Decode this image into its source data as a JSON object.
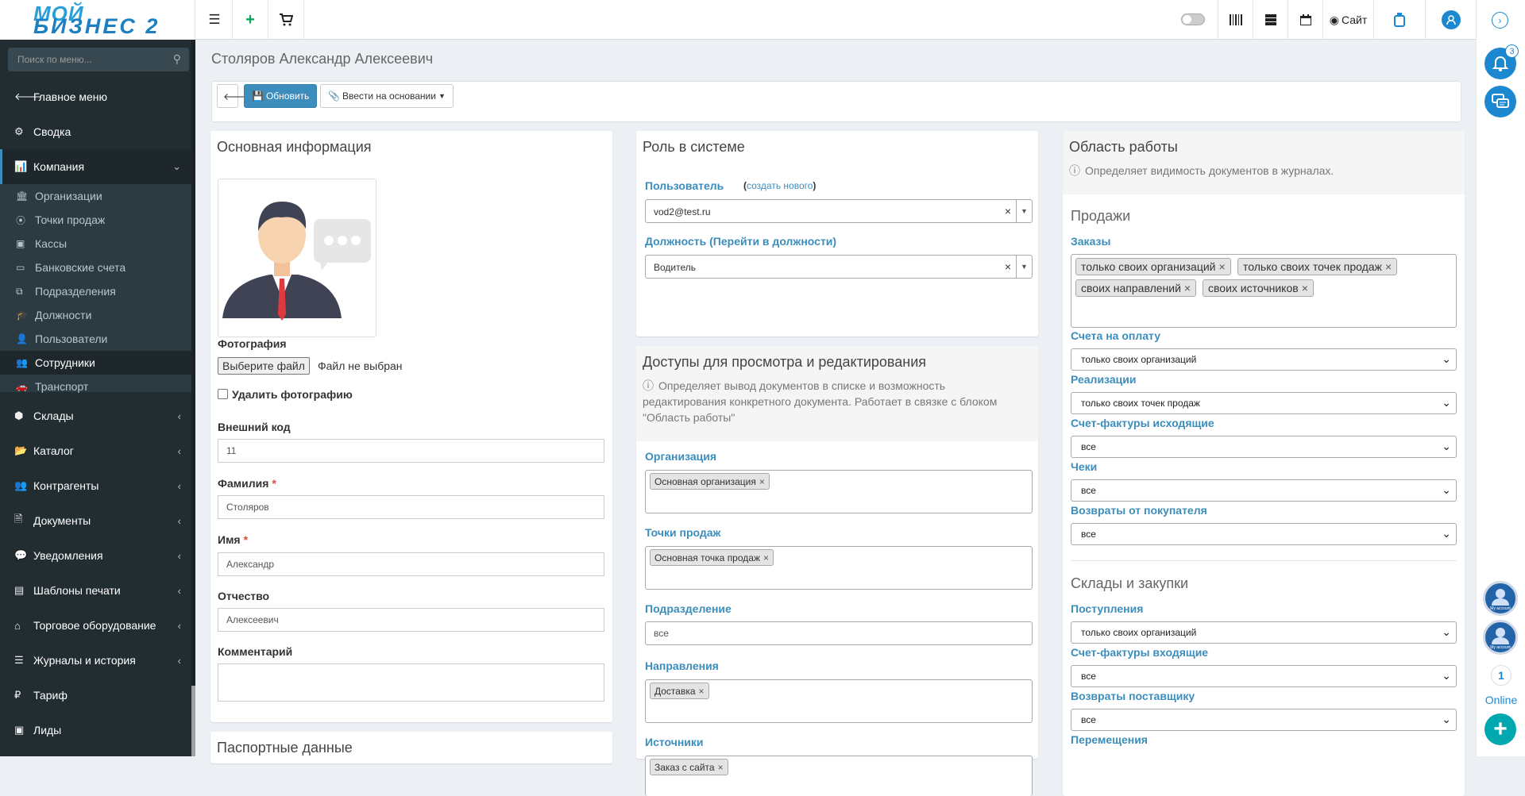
{
  "logo": {
    "line1": "МОЙ",
    "line2": "БИЗНЕС 2"
  },
  "topbar": {
    "site_label": "Сайт"
  },
  "sidebar": {
    "search_placeholder": "Поиск по меню...",
    "items": [
      {
        "label": "Главное меню"
      },
      {
        "label": "Сводка"
      },
      {
        "label": "Компания"
      },
      {
        "label": "Склады"
      },
      {
        "label": "Каталог"
      },
      {
        "label": "Контрагенты"
      },
      {
        "label": "Документы"
      },
      {
        "label": "Уведомления"
      },
      {
        "label": "Шаблоны печати"
      },
      {
        "label": "Торговое оборудование"
      },
      {
        "label": "Журналы и история"
      },
      {
        "label": "Тариф"
      },
      {
        "label": "Лиды"
      }
    ],
    "sub": [
      {
        "label": "Организации"
      },
      {
        "label": "Точки продаж"
      },
      {
        "label": "Кассы"
      },
      {
        "label": "Банковские счета"
      },
      {
        "label": "Подразделения"
      },
      {
        "label": "Должности"
      },
      {
        "label": "Пользователи"
      },
      {
        "label": "Сотрудники"
      },
      {
        "label": "Транспорт"
      }
    ]
  },
  "page": {
    "title": "Столяров Александр Алексеевич",
    "refresh_label": "Обновить",
    "base_label": "Ввести на основании"
  },
  "main": {
    "header": "Основная информация",
    "photo_label": "Фотография",
    "choose_file": "Выберите файл",
    "no_file": "Файл не выбран",
    "delete_photo": "Удалить фотографию",
    "ext_code_label": "Внешний код",
    "ext_code": "11",
    "last_name_label": "Фамилия",
    "last_name": "Столяров",
    "first_name_label": "Имя",
    "first_name": "Александр",
    "middle_name_label": "Отчество",
    "middle_name": "Алексеевич",
    "comment_label": "Комментарий",
    "passport_header": "Паспортные данные"
  },
  "role": {
    "header": "Роль в системе",
    "user_label": "Пользователь",
    "create_new": "создать нового",
    "user_value": "vod2@test.ru",
    "position_label": "Должность (Перейти в должности)",
    "position_value": "Водитель"
  },
  "access": {
    "header": "Доступы для просмотра и редактирования",
    "info": "Определяет вывод документов в списке и возможность редактирования конкретного документа. Работает в связке с блоком \"Область работы\"",
    "org_label": "Организация",
    "org_tags": [
      "Основная организация"
    ],
    "pos_label": "Точки продаж",
    "pos_tags": [
      "Основная точка продаж"
    ],
    "dept_label": "Подразделение",
    "dept_value": "все",
    "dir_label": "Направления",
    "dir_tags": [
      "Доставка"
    ],
    "src_label": "Источники",
    "src_tags": [
      "Заказ с сайта"
    ]
  },
  "work": {
    "header": "Область работы",
    "info": "Определяет видимость документов в журналах.",
    "sales_header": "Продажи",
    "orders_label": "Заказы",
    "orders_tags": [
      "только своих организаций",
      "только своих точек продаж",
      "своих направлений",
      "своих источников"
    ],
    "invoices_label": "Счета на оплату",
    "invoices_value": "только своих организаций",
    "realization_label": "Реализации",
    "realization_value": "только своих точек продаж",
    "sf_out_label": "Счет-фактуры исходящие",
    "sf_out_value": "все",
    "checks_label": "Чеки",
    "checks_value": "все",
    "returns_label": "Возвраты от покупателя",
    "returns_value": "все",
    "stock_header": "Склады и закупки",
    "receipts_label": "Поступления",
    "receipts_value": "только своих организаций",
    "sf_in_label": "Счет-фактуры входящие",
    "sf_in_value": "все",
    "ret_sup_label": "Возвраты поставщику",
    "ret_sup_value": "все",
    "moves_label": "Перемещения"
  },
  "right": {
    "badge": "3",
    "online_count": "1",
    "online_label": "Online",
    "avatar_caption": "My account"
  },
  "colors": {
    "accent": "#3c8dbc",
    "sidebar": "#222d32",
    "green": "#00a65a"
  }
}
